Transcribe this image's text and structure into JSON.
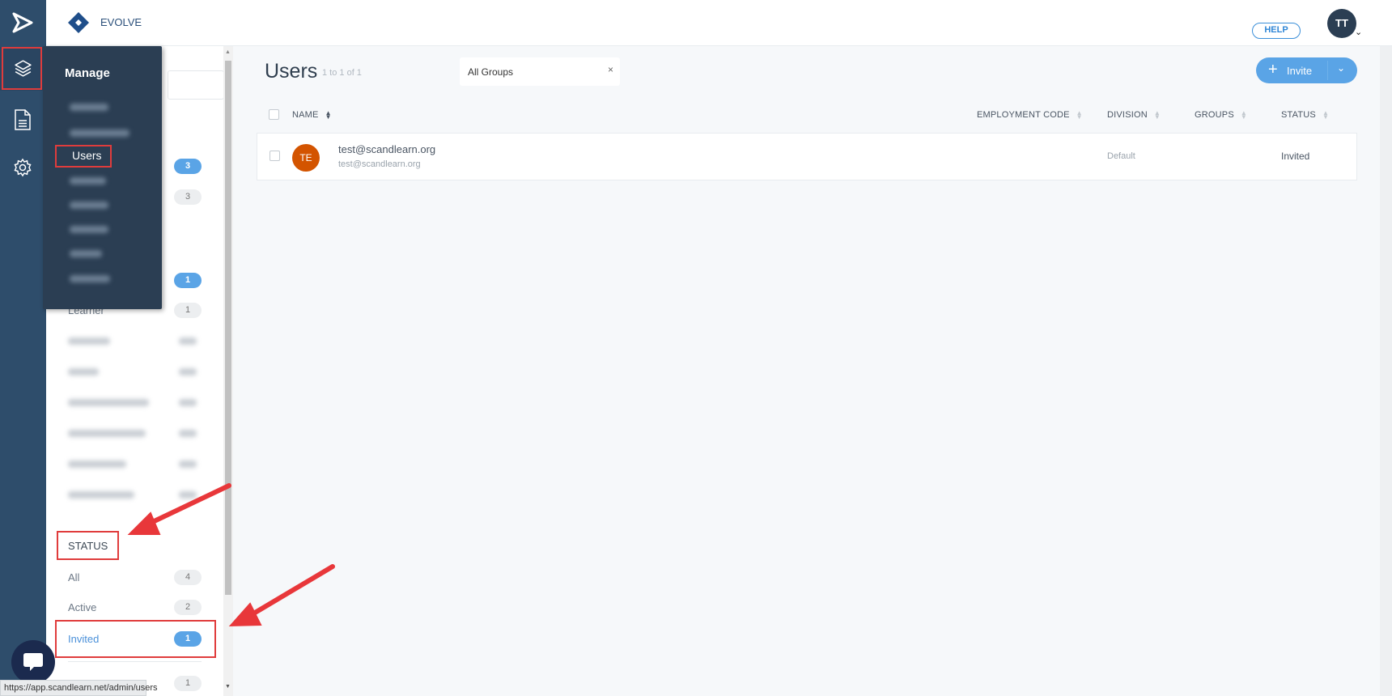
{
  "header": {
    "brand": "EVOLVE",
    "help_label": "HELP",
    "avatar_initials": "TT"
  },
  "flyout": {
    "title": "Manage",
    "active_item": "Users"
  },
  "filters": {
    "badges_top": [
      {
        "count": "3",
        "active": true
      },
      {
        "count": "3",
        "active": false
      },
      {
        "count": "1",
        "active": true
      }
    ],
    "learner": {
      "label": "Learner",
      "count": "1"
    },
    "status_heading": "STATUS",
    "status_items": [
      {
        "label": "All",
        "count": "4",
        "active": false
      },
      {
        "label": "Active",
        "count": "2",
        "active": false
      },
      {
        "label": "Invited",
        "count": "1",
        "active": true
      }
    ],
    "last_badge": "1"
  },
  "main": {
    "title": "Users",
    "count_text": "1 to 1 of 1",
    "group_filter": "All Groups",
    "clear_symbol": "×",
    "invite_label": "Invite",
    "columns": [
      "NAME",
      "EMPLOYMENT CODE",
      "DIVISION",
      "GROUPS",
      "STATUS"
    ],
    "rows": [
      {
        "initials": "TE",
        "name": "test@scandlearn.org",
        "email": "test@scandlearn.org",
        "employment_code": "",
        "division": "Default",
        "groups": "",
        "status": "Invited"
      }
    ]
  },
  "status_bar_url": "https://app.scandlearn.net/admin/users",
  "colors": {
    "rail": "#2e4d6b",
    "accent": "#5aa4e6",
    "avatar_row": "#d35400",
    "annotation": "#e03c3c"
  }
}
